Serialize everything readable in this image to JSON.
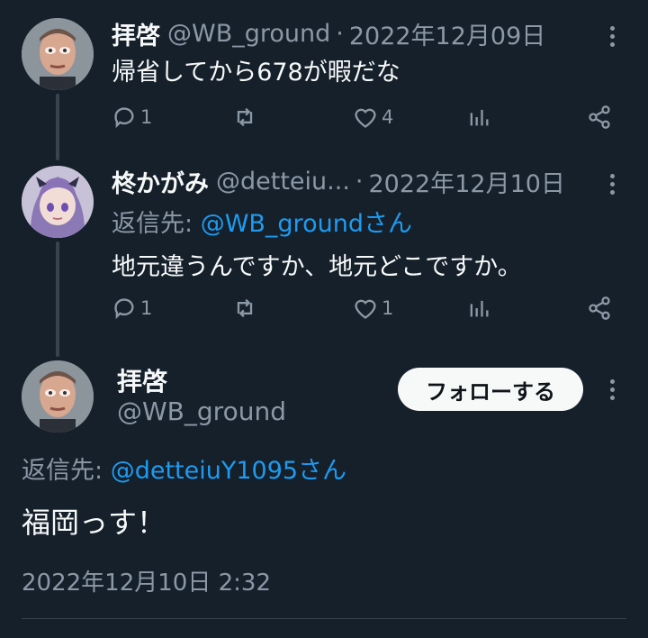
{
  "tweet1": {
    "display_name": "拝啓",
    "handle": "@WB_ground",
    "separator": "·",
    "date": "2022年12月09日",
    "text": "帰省してから678が暇だな",
    "reply_count": "1",
    "retweet_count": "",
    "like_count": "4",
    "icons": [
      "avatar-man-photo",
      "more-icon",
      "reply-icon",
      "retweet-icon",
      "like-icon",
      "stats-icon",
      "share-icon"
    ]
  },
  "tweet2": {
    "display_name": "柊かがみ",
    "handle": "@detteiu...",
    "separator": "·",
    "date": "2022年12月10日",
    "reply_prefix": "返信先:",
    "reply_target": "@WB_groundさん",
    "text": "地元違うんですか、地元どこですか。",
    "reply_count": "1",
    "retweet_count": "",
    "like_count": "1",
    "icons": [
      "avatar-anime-girl",
      "more-icon",
      "reply-icon",
      "retweet-icon",
      "like-icon",
      "stats-icon",
      "share-icon"
    ]
  },
  "focus_tweet": {
    "display_name": "拝啓",
    "handle": "@WB_ground",
    "follow_label": "フォローする",
    "reply_prefix": "返信先:",
    "reply_target": "@detteiuY1095さん",
    "text": "福岡っす！",
    "timestamp": "2022年12月10日 2:32"
  },
  "colors": {
    "background": "#15202b",
    "text_primary": "#f7f9f9",
    "text_secondary": "#8b98a5",
    "link": "#1d9bf0",
    "thread_line": "#38444d",
    "follow_button_bg": "#f7f9f9"
  }
}
